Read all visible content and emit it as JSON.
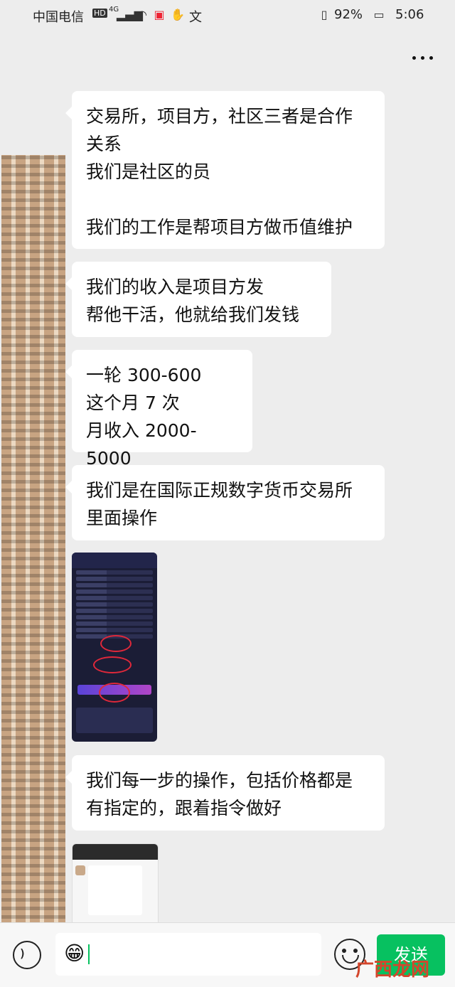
{
  "status_bar": {
    "carrier": "中国电信",
    "hd_label": "HD",
    "network": "4G",
    "input_method": "文",
    "battery": "92%",
    "time": "5:06"
  },
  "messages": [
    {
      "type": "text",
      "text": "交易所，项目方，社区三者是合作\n关系\n我们是社区的员\n\n我们的工作是帮项目方做币值维护"
    },
    {
      "type": "text",
      "text": "我们的收入是项目方发\n帮他干活，他就给我们发钱"
    },
    {
      "type": "text",
      "text": "一轮 300-600\n这个月 7 次\n月收入 2000-5000"
    },
    {
      "type": "text",
      "text": "我们是在国际正规数字货币交易所\n里面操作"
    },
    {
      "type": "image",
      "description_icon": "trading-app-screenshot"
    },
    {
      "type": "text",
      "text": "我们每一步的操作，包括价格都是\n有指定的，跟着指令做好"
    },
    {
      "type": "image",
      "description_icon": "chat-screenshot"
    }
  ],
  "input": {
    "emoji": "😁",
    "send_label": "发送"
  },
  "watermark": "广西龙网"
}
